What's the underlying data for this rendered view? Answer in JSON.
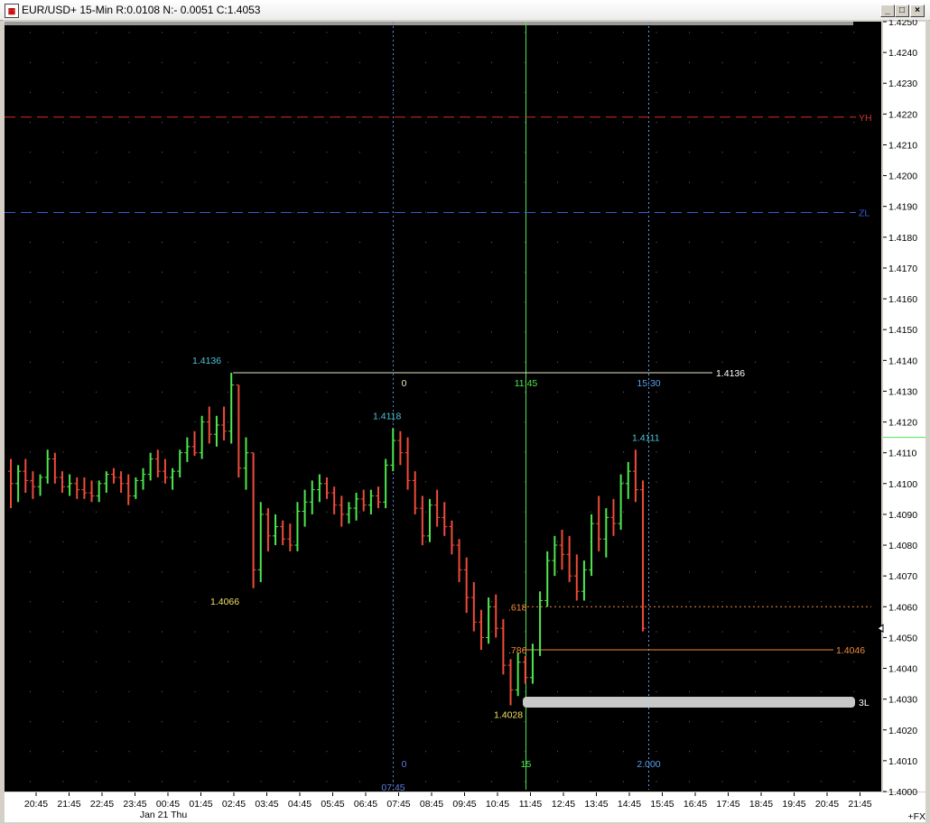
{
  "window": {
    "title": "EUR/USD+ 15-Min R:0.0108 N:- 0.0051 C:1.4053",
    "icon_name": "chart-app-icon",
    "controls": [
      "minimize-icon",
      "maximize-icon",
      "close-icon"
    ]
  },
  "colors": {
    "background": "#000000",
    "up_bar": "#4ee84e",
    "down_bar": "#f04b3a",
    "yh_line": "#d62f2f",
    "zl_line": "#3a5bd9",
    "marker_text": "#4fc3d9",
    "low_text": "#f0e060",
    "fib_text": "#f08a3a",
    "time_line": "#4ee84e"
  },
  "chart_data": {
    "type": "ohlc",
    "symbol": "EUR/USD+",
    "interval": "15-Min",
    "ylim": [
      1.4,
      1.425
    ],
    "y_ticks": [
      "1.4250",
      "1.4240",
      "1.4230",
      "1.4220",
      "1.4210",
      "1.4200",
      "1.4190",
      "1.4180",
      "1.4170",
      "1.4160",
      "1.4150",
      "1.4140",
      "1.4130",
      "1.4120",
      "1.4110",
      "1.4100",
      "1.4090",
      "1.4080",
      "1.4070",
      "1.4060",
      "1.4050",
      "1.4040",
      "1.4030",
      "1.4020",
      "1.4010",
      "1.4000"
    ],
    "x_ticks": [
      "20:45",
      "21:45",
      "22:45",
      "23:45",
      "00:45",
      "01:45",
      "02:45",
      "03:45",
      "04:45",
      "05:45",
      "06:45",
      "07:45",
      "08:45",
      "09:45",
      "10:45",
      "11:45",
      "12:45",
      "13:45",
      "14:45",
      "15:45",
      "16:45",
      "17:45",
      "18:45",
      "19:45",
      "20:45",
      "21:45"
    ],
    "date_label": "Jan 21 Thu",
    "right_footer": "+FX",
    "bars": [
      [
        1.4104,
        1.4108,
        1.4092,
        1.41
      ],
      [
        1.41,
        1.4106,
        1.4094,
        1.4104
      ],
      [
        1.4104,
        1.4108,
        1.4097,
        1.4101
      ],
      [
        1.4101,
        1.4104,
        1.4095,
        1.4099
      ],
      [
        1.4099,
        1.4103,
        1.4096,
        1.4102
      ],
      [
        1.4102,
        1.4111,
        1.41,
        1.4108
      ],
      [
        1.4108,
        1.411,
        1.41,
        1.4102
      ],
      [
        1.4102,
        1.4104,
        1.4097,
        1.4099
      ],
      [
        1.4099,
        1.4103,
        1.4096,
        1.41
      ],
      [
        1.41,
        1.4102,
        1.4095,
        1.4098
      ],
      [
        1.4098,
        1.4102,
        1.4095,
        1.4097
      ],
      [
        1.4097,
        1.4101,
        1.4094,
        1.4096
      ],
      [
        1.4096,
        1.4101,
        1.4094,
        1.41
      ],
      [
        1.41,
        1.4104,
        1.4097,
        1.4103
      ],
      [
        1.4103,
        1.4105,
        1.41,
        1.4102
      ],
      [
        1.4102,
        1.4104,
        1.4097,
        1.41
      ],
      [
        1.41,
        1.4103,
        1.4093,
        1.4096
      ],
      [
        1.4096,
        1.4102,
        1.4095,
        1.4101
      ],
      [
        1.4101,
        1.4105,
        1.4098,
        1.4103
      ],
      [
        1.4103,
        1.411,
        1.4101,
        1.4108
      ],
      [
        1.4108,
        1.4111,
        1.4102,
        1.4104
      ],
      [
        1.4104,
        1.4108,
        1.41,
        1.4102
      ],
      [
        1.4102,
        1.4105,
        1.4098,
        1.4104
      ],
      [
        1.4104,
        1.4111,
        1.4102,
        1.411
      ],
      [
        1.411,
        1.4115,
        1.4107,
        1.4112
      ],
      [
        1.4112,
        1.4117,
        1.4109,
        1.411
      ],
      [
        1.411,
        1.4122,
        1.4108,
        1.412
      ],
      [
        1.412,
        1.4125,
        1.4113,
        1.4116
      ],
      [
        1.4116,
        1.4122,
        1.4112,
        1.4119
      ],
      [
        1.4119,
        1.4125,
        1.4114,
        1.4117
      ],
      [
        1.4117,
        1.4136,
        1.4113,
        1.4132
      ],
      [
        1.4132,
        1.4132,
        1.4102,
        1.4105
      ],
      [
        1.4105,
        1.4115,
        1.4098,
        1.411
      ],
      [
        1.411,
        1.411,
        1.4066,
        1.4072
      ],
      [
        1.4072,
        1.4094,
        1.4068,
        1.409
      ],
      [
        1.409,
        1.4092,
        1.4078,
        1.4083
      ],
      [
        1.4083,
        1.409,
        1.408,
        1.4086
      ],
      [
        1.4086,
        1.4088,
        1.408,
        1.4082
      ],
      [
        1.4082,
        1.4087,
        1.4078,
        1.408
      ],
      [
        1.408,
        1.4094,
        1.4078,
        1.4091
      ],
      [
        1.4091,
        1.4098,
        1.4086,
        1.4094
      ],
      [
        1.4094,
        1.4101,
        1.409,
        1.4098
      ],
      [
        1.4098,
        1.4103,
        1.4094,
        1.41
      ],
      [
        1.41,
        1.4102,
        1.4095,
        1.4097
      ],
      [
        1.4097,
        1.4099,
        1.409,
        1.4093
      ],
      [
        1.4093,
        1.4096,
        1.4086,
        1.409
      ],
      [
        1.409,
        1.4094,
        1.4087,
        1.4092
      ],
      [
        1.4092,
        1.4097,
        1.4088,
        1.4095
      ],
      [
        1.4095,
        1.4098,
        1.4091,
        1.4093
      ],
      [
        1.4093,
        1.4098,
        1.409,
        1.4096
      ],
      [
        1.4096,
        1.4099,
        1.4092,
        1.4094
      ],
      [
        1.4094,
        1.4108,
        1.4092,
        1.4106
      ],
      [
        1.4106,
        1.4118,
        1.4104,
        1.4114
      ],
      [
        1.4114,
        1.4117,
        1.4106,
        1.411
      ],
      [
        1.411,
        1.4115,
        1.4098,
        1.4101
      ],
      [
        1.4101,
        1.4104,
        1.409,
        1.4092
      ],
      [
        1.4092,
        1.4096,
        1.408,
        1.4083
      ],
      [
        1.4083,
        1.4095,
        1.4081,
        1.4093
      ],
      [
        1.4093,
        1.4098,
        1.4086,
        1.4089
      ],
      [
        1.4089,
        1.4094,
        1.4083,
        1.4086
      ],
      [
        1.4086,
        1.4088,
        1.4077,
        1.408
      ],
      [
        1.408,
        1.4082,
        1.4068,
        1.4072
      ],
      [
        1.4072,
        1.4076,
        1.4058,
        1.4063
      ],
      [
        1.4063,
        1.4068,
        1.4052,
        1.4055
      ],
      [
        1.4055,
        1.4059,
        1.4046,
        1.405
      ],
      [
        1.405,
        1.4063,
        1.4048,
        1.406
      ],
      [
        1.406,
        1.4064,
        1.405,
        1.4053
      ],
      [
        1.4053,
        1.4056,
        1.4038,
        1.4041
      ],
      [
        1.4041,
        1.4043,
        1.4028,
        1.4033
      ],
      [
        1.4033,
        1.4045,
        1.4031,
        1.4042
      ],
      [
        1.4042,
        1.4044,
        1.4035,
        1.4037
      ],
      [
        1.4037,
        1.4048,
        1.4035,
        1.4046
      ],
      [
        1.4046,
        1.4065,
        1.4044,
        1.4062
      ],
      [
        1.4062,
        1.4078,
        1.406,
        1.4075
      ],
      [
        1.4075,
        1.4083,
        1.407,
        1.408
      ],
      [
        1.408,
        1.4085,
        1.4072,
        1.4077
      ],
      [
        1.4077,
        1.4083,
        1.4068,
        1.407
      ],
      [
        1.407,
        1.4077,
        1.4062,
        1.4065
      ],
      [
        1.4065,
        1.4075,
        1.4062,
        1.4072
      ],
      [
        1.4072,
        1.409,
        1.407,
        1.4087
      ],
      [
        1.4087,
        1.4096,
        1.4078,
        1.4082
      ],
      [
        1.4082,
        1.4092,
        1.4076,
        1.4089
      ],
      [
        1.4089,
        1.4095,
        1.4083,
        1.4087
      ],
      [
        1.4087,
        1.4103,
        1.4085,
        1.41
      ],
      [
        1.41,
        1.4107,
        1.4095,
        1.4104
      ],
      [
        1.4104,
        1.4111,
        1.4094,
        1.4098
      ],
      [
        1.4098,
        1.4101,
        1.4052,
        1.4053
      ]
    ],
    "horizontal_lines": [
      {
        "label": "YH",
        "price": 1.4219,
        "style": "dashed",
        "color": "#d62f2f"
      },
      {
        "label": "ZL",
        "price": 1.4188,
        "style": "dashed",
        "color": "#3a5bd9"
      },
      {
        "label": "1.4136",
        "price": 1.4136,
        "style": "solid",
        "color": "#e8e8c8"
      },
      {
        "label": "1.4046",
        "price": 1.4046,
        "style": "solid",
        "color": "#f08a3a"
      },
      {
        "label": "",
        "price": 1.406,
        "style": "dotted",
        "color": "#f08a3a"
      },
      {
        "label": "3L",
        "price": 1.4029,
        "style": "band",
        "color": "#c8c8c8"
      }
    ],
    "vertical_markers": [
      {
        "time": "07:45",
        "top_label": "0",
        "bottom_label": "0",
        "color": "#5a7fe0"
      },
      {
        "time": "11:45",
        "top_label": "11:45",
        "bottom_label": "15",
        "color": "#4ee84e"
      },
      {
        "time": "15:30",
        "top_label": "15:30",
        "bottom_label": "2.000",
        "color": "#5a9ee8"
      }
    ],
    "annotations": [
      {
        "text": "1.4136",
        "price": 1.4136,
        "color": "#4fc3d9"
      },
      {
        "text": "1.4066",
        "price": 1.4066,
        "color": "#f0e060"
      },
      {
        "text": "1.4118",
        "price": 1.4118,
        "color": "#4fc3d9"
      },
      {
        "text": "1.4111",
        "price": 1.4111,
        "color": "#4fc3d9"
      },
      {
        "text": "1.4028",
        "price": 1.4028,
        "color": "#f0e060"
      },
      {
        "text": ".618",
        "price": 1.406,
        "color": "#f08a3a"
      },
      {
        "text": ".786",
        "price": 1.4046,
        "color": "#f08a3a"
      }
    ],
    "cursor_time_label": "07:45"
  }
}
